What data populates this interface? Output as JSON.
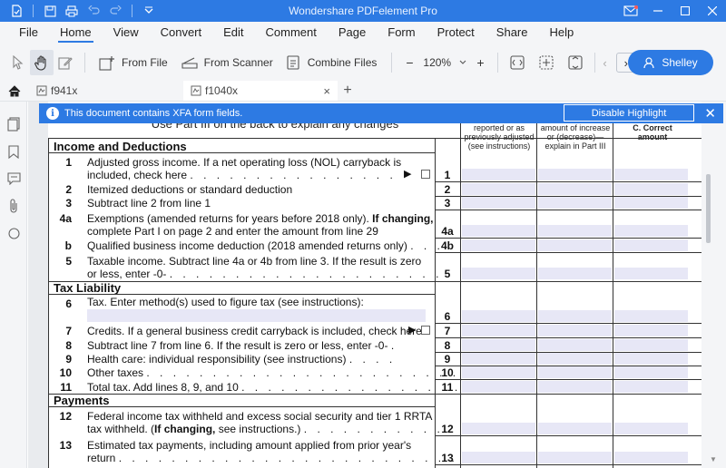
{
  "app": {
    "title": "Wondershare PDFelement Pro"
  },
  "menu": {
    "items": [
      "File",
      "Home",
      "View",
      "Convert",
      "Edit",
      "Comment",
      "Page",
      "Form",
      "Protect",
      "Share",
      "Help"
    ],
    "active": "Home"
  },
  "toolbar": {
    "from_file": "From File",
    "from_scanner": "From Scanner",
    "combine_files": "Combine Files",
    "zoom": "120%",
    "user": "Shelley"
  },
  "tabs": [
    {
      "label": "f941x"
    },
    {
      "label": "f1040x"
    }
  ],
  "notice": {
    "text": "This document contains XFA form fields.",
    "button": "Disable Highlight"
  },
  "form": {
    "top_instruction": "Use Part III on the back to explain any changes",
    "col_a": "reported or as previously adjusted (see instructions)",
    "col_b": "amount of increase or (decrease)— explain in Part III",
    "col_c_1": "C. Correct",
    "col_c_2": "amount",
    "sections": {
      "income": "Income and Deductions",
      "tax": "Tax Liability",
      "payments": "Payments"
    },
    "lines": {
      "l1_num": "1",
      "l1_a": "Adjusted gross income. If a net operating loss (NOL) carryback is",
      "l1_b": "included, check here",
      "l2_num": "2",
      "l2": "Itemized deductions or standard deduction",
      "l3_num": "3",
      "l3": "Subtract line 2 from line 1",
      "l4a_num": "4a",
      "l4a_a": "Exemptions (amended returns for years before 2018 only).",
      "l4a_bold": "If changing,",
      "l4a_b": "complete Part I on page 2 and enter the amount from line 29",
      "l4b_num": "b",
      "l4b": "Qualified business income deduction (2018 amended returns only)",
      "l5_num": "5",
      "l5_a": "Taxable income. Subtract line 4a or 4b from line 3. If the result is zero",
      "l5_b": "or less, enter -0-",
      "l6_num": "6",
      "l6": "Tax. Enter method(s) used to figure tax (see instructions):",
      "l7_num": "7",
      "l7": "Credits. If a general business credit carryback is included, check here",
      "l8_num": "8",
      "l8": "Subtract line 7 from line 6. If the result is zero or less, enter -0-",
      "l9_num": "9",
      "l9": "Health care: individual responsibility (see instructions)",
      "l10_num": "10",
      "l10": "Other taxes",
      "l11_num": "11",
      "l11": "Total tax. Add lines 8, 9, and 10",
      "l12_num": "12",
      "l12_a": "Federal income tax withheld and excess social security and tier 1 RRTA",
      "l12_b_pre": "tax withheld. (",
      "l12_bold": "If changing,",
      "l12_b_post": " see instructions.)",
      "l13_num": "13",
      "l13_a": "Estimated tax payments, including amount applied from prior year's",
      "l13_b": "return"
    },
    "box_numbers": [
      "1",
      "2",
      "3",
      "4a",
      "4b",
      "5",
      "6",
      "7",
      "8",
      "9",
      "10",
      "11",
      "12",
      "13"
    ]
  },
  "icons": {
    "save": "save-icon",
    "print": "print-icon",
    "undo": "undo-icon",
    "redo": "redo-icon",
    "mail": "mail-icon"
  },
  "colors": {
    "accent": "#2d7ae3",
    "field_highlight": "#e7e7f6"
  }
}
